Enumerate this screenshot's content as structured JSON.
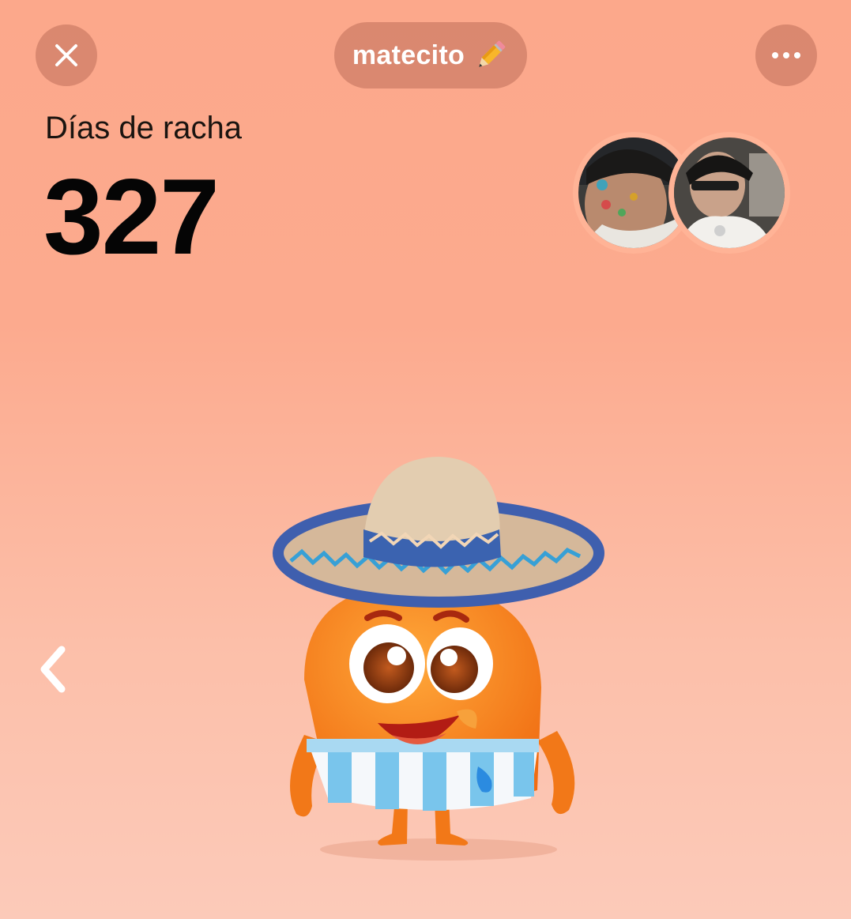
{
  "header": {
    "title": "matecito",
    "title_emoji": "✏️",
    "close_icon": "close-icon",
    "more_icon": "more-horizontal-icon"
  },
  "streak": {
    "label": "Días de racha",
    "count": "327"
  },
  "participants": [
    {
      "name": "avatar-user-1"
    },
    {
      "name": "avatar-user-2"
    }
  ],
  "navigation": {
    "back_icon": "chevron-left-icon"
  },
  "mascot": {
    "name": "orange-mascot-sombrero"
  },
  "colors": {
    "background_top": "#fca88b",
    "background_bottom": "#fccab9",
    "pill_bg": "#be6e5a",
    "mascot_orange": "#f5801e",
    "shirt_blue": "#79c5ec"
  }
}
